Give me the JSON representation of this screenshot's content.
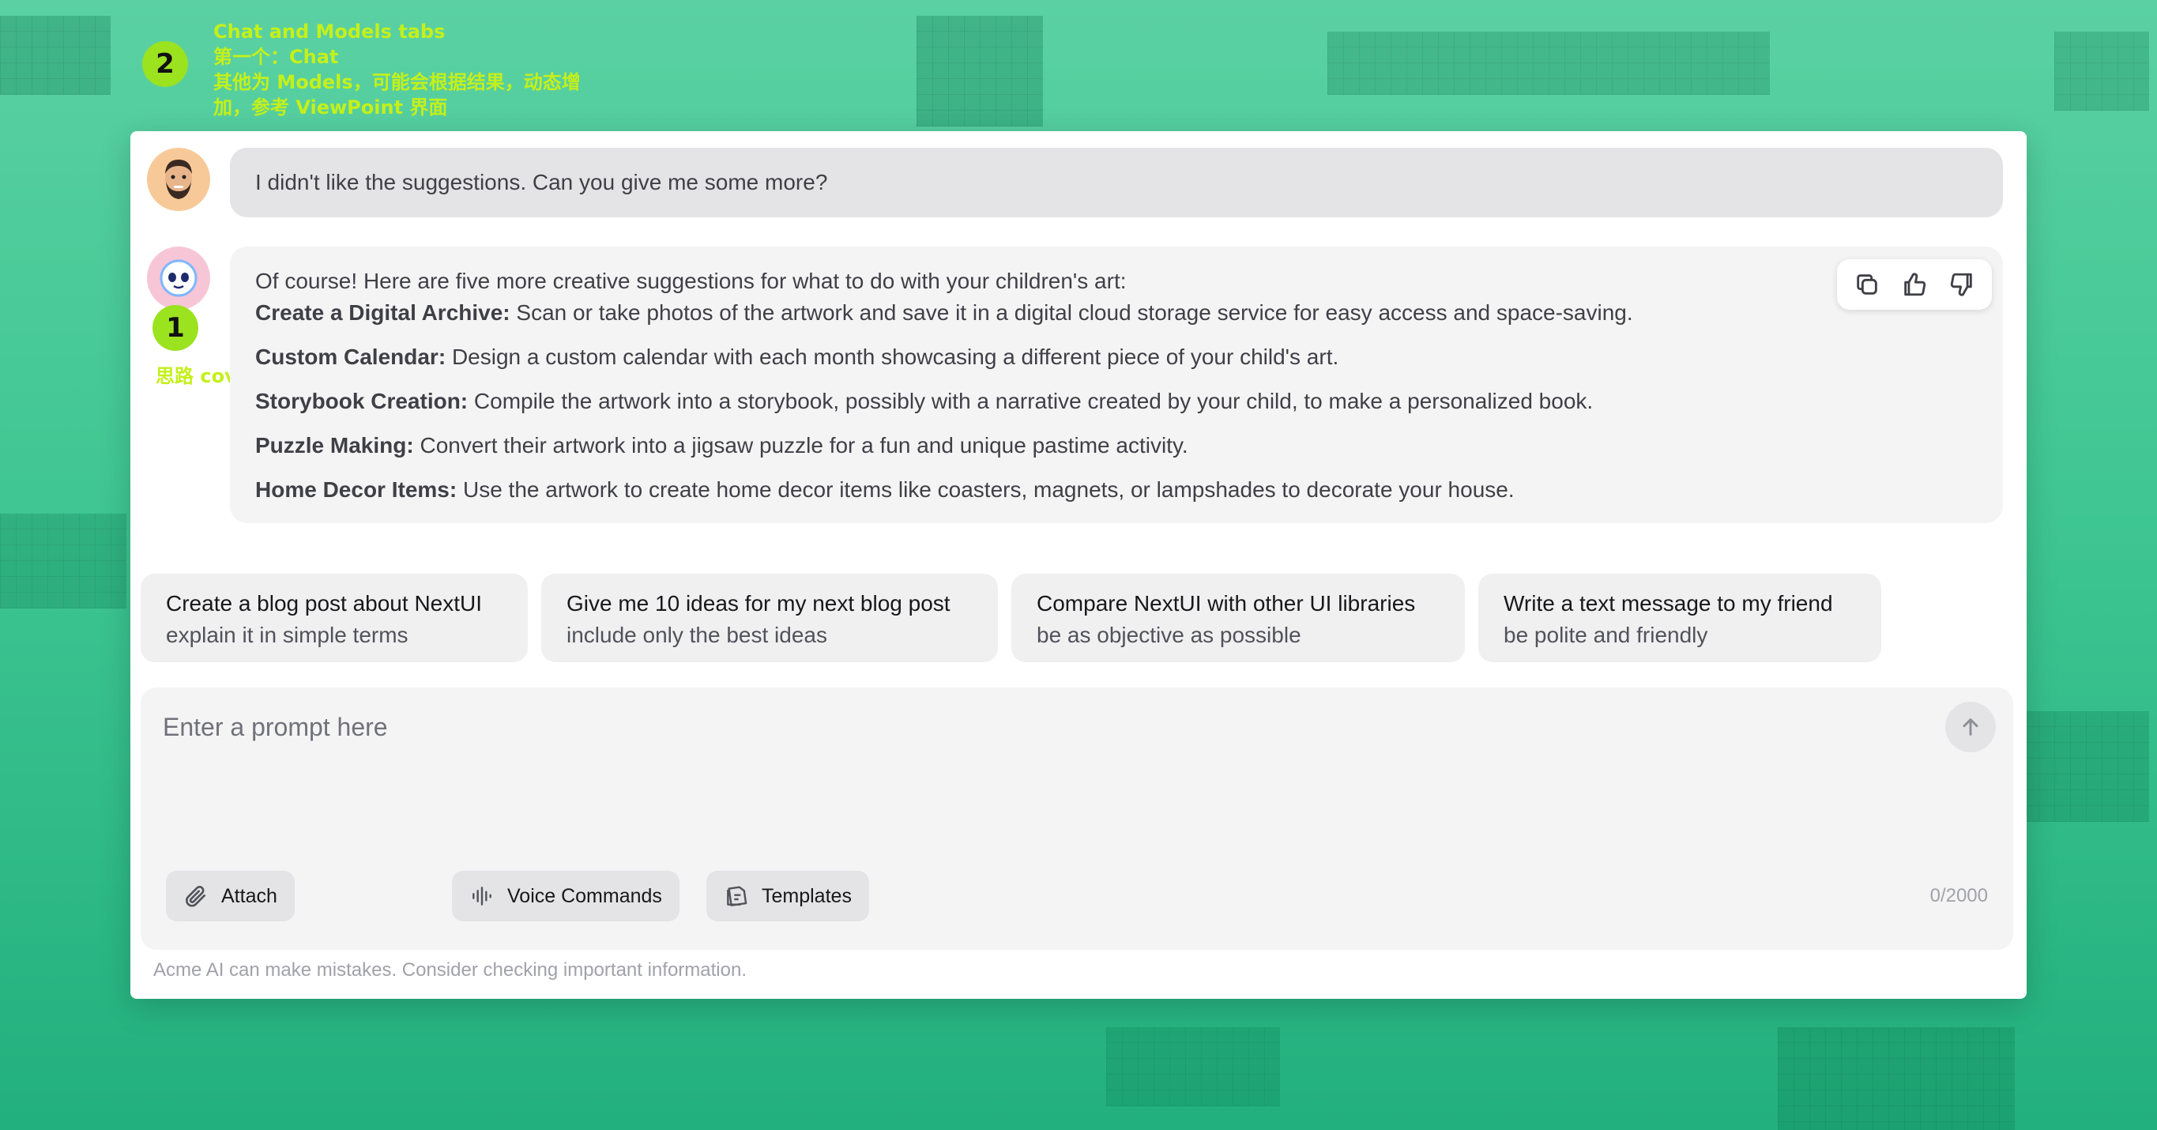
{
  "annotations": {
    "num_1": "1",
    "num_2": "2",
    "note_1": "思路 cover",
    "note_2_lines": [
      "Chat and Models tabs",
      "第一个：Chat",
      "其他为 Models，可能会根据结果，动态增",
      "加，参考 ViewPoint 界面"
    ],
    "color": "#c4f01a"
  },
  "chat": {
    "user_message": "I didn't like the suggestions. Can you give me some more?",
    "assistant": {
      "intro": "Of course! Here are five more creative suggestions for what to do with your children's art:",
      "items": [
        {
          "title": "Create a Digital Archive:",
          "text": "Scan or take photos of the artwork and save it in a digital cloud storage service for easy access and space-saving."
        },
        {
          "title": "Custom Calendar:",
          "text": "Design a custom calendar with each month showcasing a different piece of your child's art."
        },
        {
          "title": "Storybook Creation:",
          "text": "Compile the artwork into a storybook, possibly with a narrative created by your child, to make a personalized book."
        },
        {
          "title": "Puzzle Making:",
          "text": "Convert their artwork into a jigsaw puzzle for a fun and unique pastime activity."
        },
        {
          "title": "Home Decor Items:",
          "text": "Use the artwork to create home decor items like coasters, magnets, or lampshades to decorate your house."
        }
      ]
    },
    "actions": [
      "copy-icon",
      "thumbs-up-icon",
      "thumbs-down-icon"
    ]
  },
  "suggestions": [
    {
      "title": "Create a blog post about NextUI",
      "subtitle": "explain it in simple terms"
    },
    {
      "title": "Give me 10 ideas for my next blog post",
      "subtitle": "include only the best ideas"
    },
    {
      "title": "Compare NextUI with other UI libraries",
      "subtitle": "be as objective as possible"
    },
    {
      "title": "Write a text message to my friend",
      "subtitle": "be polite and friendly"
    }
  ],
  "composer": {
    "placeholder": "Enter a prompt here",
    "attach_label": "Attach",
    "voice_label": "Voice Commands",
    "templates_label": "Templates",
    "counter": "0/2000"
  },
  "disclaimer": "Acme AI can make mistakes. Consider checking important information."
}
